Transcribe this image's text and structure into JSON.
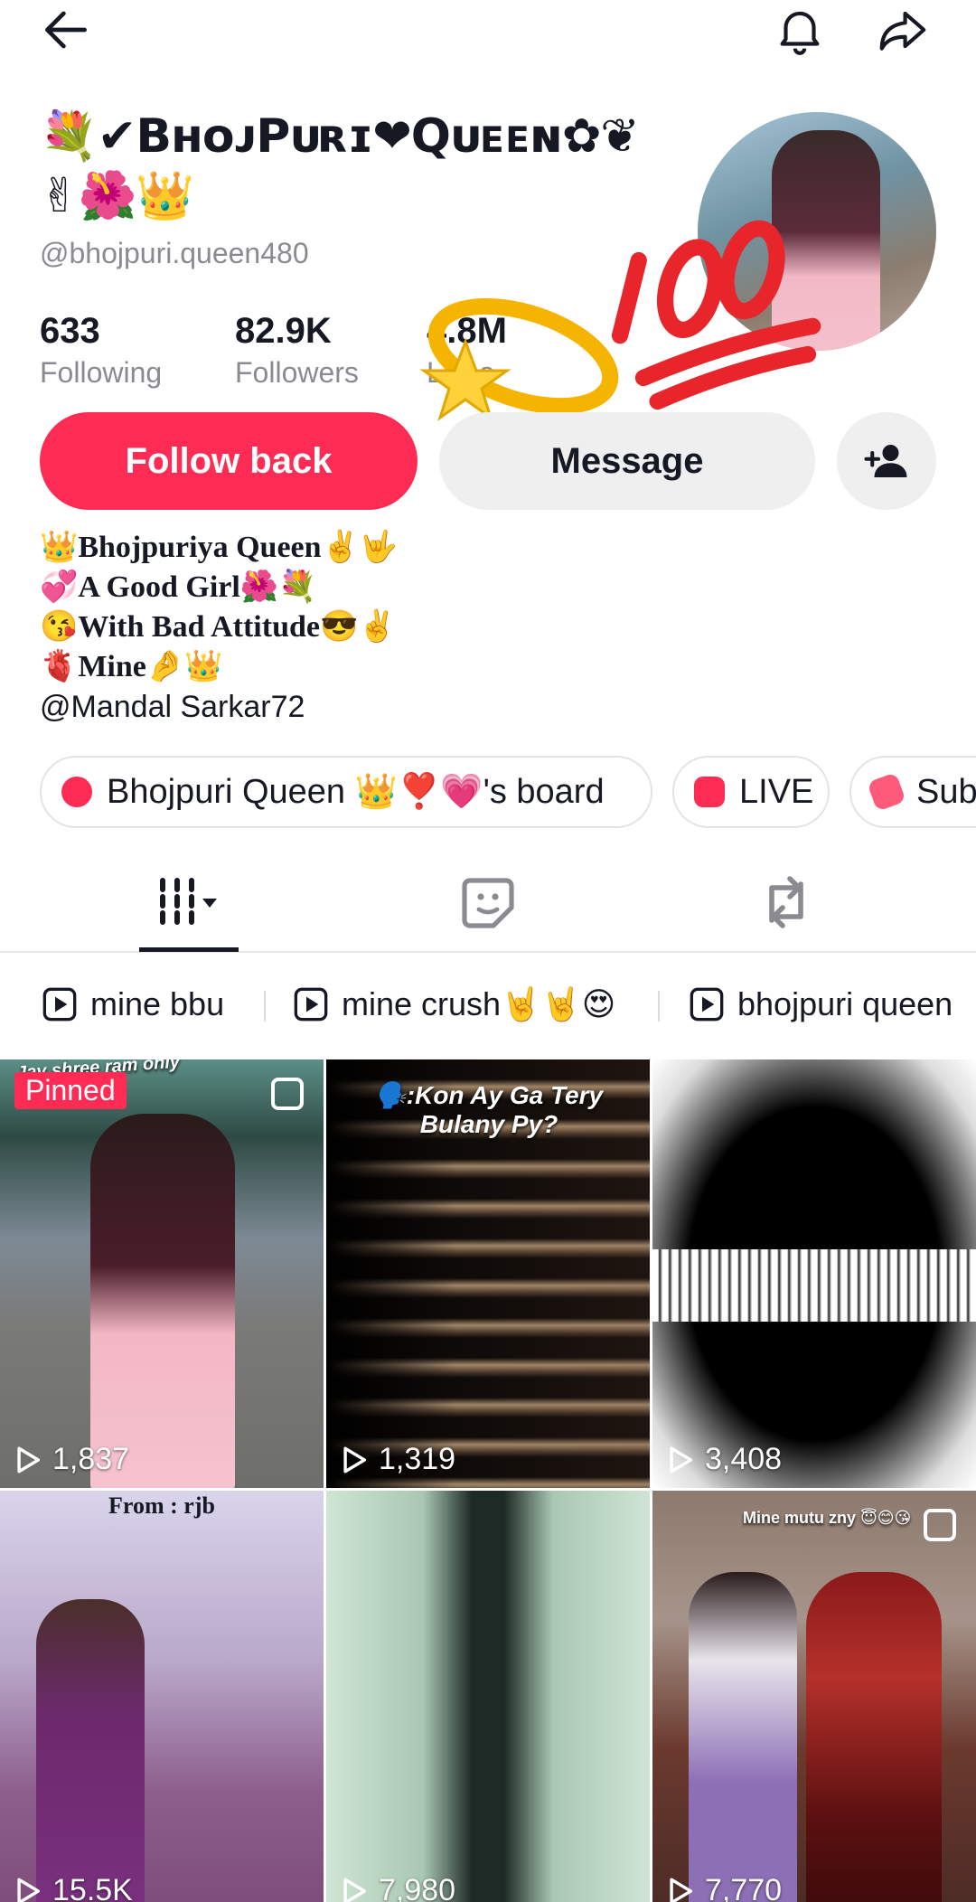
{
  "profile": {
    "display_name": "💐✔BʜᴏᴊPᴜʀɪ❤Qᴜᴇᴇɴ✿❦",
    "display_name_line2": "✌🌺👑",
    "username": "@bhojpuri.queen480",
    "stats": {
      "following": {
        "value": "633",
        "label": "Following"
      },
      "followers": {
        "value": "82.9K",
        "label": "Followers"
      },
      "likes": {
        "value": "4.8M",
        "label": "Likes"
      }
    },
    "bio_lines": [
      "👑Bhojpuriya Queen✌🤟",
      "💞A Good Girl🌺💐",
      "😘With Bad Attitude😎✌",
      "🫀Mine🤌👑"
    ],
    "bio_mention": "@Mandal Sarkar72"
  },
  "actions": {
    "follow_back": "Follow back",
    "message": "Message"
  },
  "pills": {
    "board": "Bhojpuri Queen 👑❣️💗's board",
    "live": "LIVE",
    "subscription": "Sub"
  },
  "playlists": [
    {
      "label": "mine bbu"
    },
    {
      "label": "mine crush🤘🤘😍"
    },
    {
      "label": "bhojpuri queen"
    }
  ],
  "videos": [
    {
      "views": "1,837",
      "pinned_label": "Pinned",
      "caption": "Jay shree ram only"
    },
    {
      "views": "1,319",
      "caption": "🗣️:Kon Ay Ga Tery Bulany Py?"
    },
    {
      "views": "3,408"
    },
    {
      "views": "15.5K",
      "caption": "From : rjb"
    },
    {
      "views": "7,980"
    },
    {
      "views": "7,770",
      "caption": "Mine mutu zny 😇😊😘"
    }
  ],
  "colors": {
    "accent": "#fe2c55",
    "secondary_button": "#efeff0",
    "muted_text": "#8a8b91",
    "text": "#161823"
  },
  "icons": [
    "back-arrow-icon",
    "bell-icon",
    "share-icon",
    "add-friend-icon",
    "videos-grid-icon",
    "favorites-icon",
    "repost-icon",
    "play-icon",
    "multi-image-icon"
  ]
}
